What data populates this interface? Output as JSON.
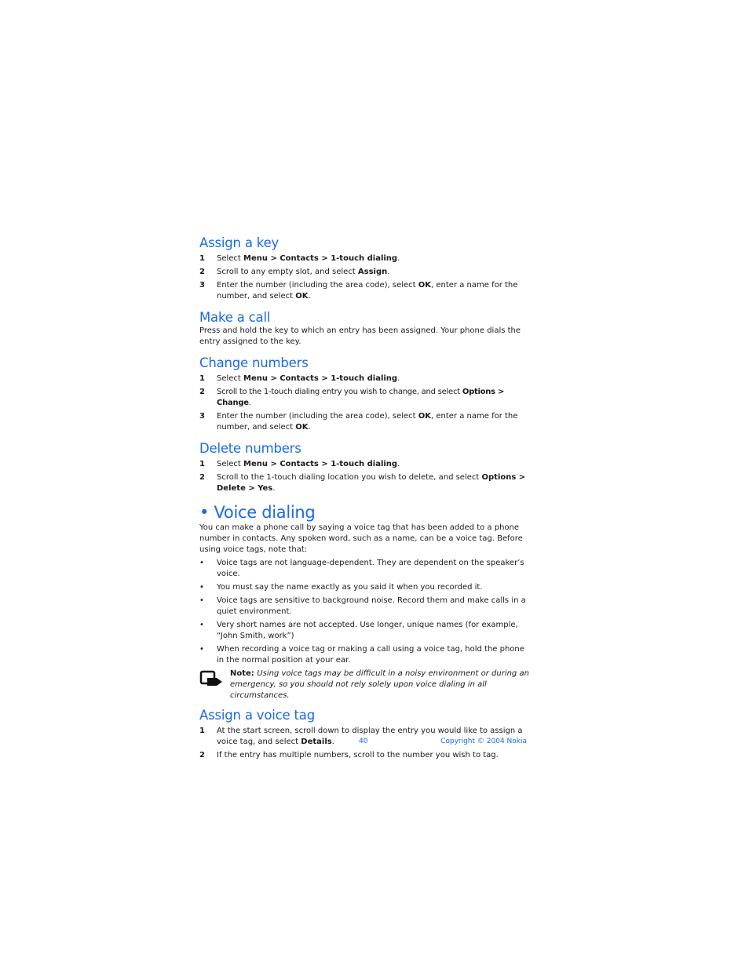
{
  "sections": {
    "assign_key": {
      "title": "Assign a key",
      "steps": [
        {
          "num": "1",
          "pre": "Select ",
          "b1": "Menu > Contacts > 1-touch dialing",
          "post": "."
        },
        {
          "num": "2",
          "pre": "Scroll to any empty slot, and select ",
          "b1": "Assign",
          "post": "."
        },
        {
          "num": "3",
          "pre": "Enter the number (including the area code), select ",
          "b1": "OK",
          "mid": ", enter a name for the number, and select ",
          "b2": "OK",
          "post": "."
        }
      ]
    },
    "make_call": {
      "title": "Make a call",
      "text": "Press and hold the key to which an entry has been assigned. Your phone dials the entry assigned to the key."
    },
    "change_numbers": {
      "title": "Change numbers",
      "steps": [
        {
          "num": "1",
          "pre": "Select ",
          "b1": "Menu > Contacts > 1-touch dialing",
          "post": "."
        },
        {
          "num": "2",
          "pre": "Scroll to the 1-touch dialing entry you wish to change, and select ",
          "b1": "Options > Change",
          "post": "."
        },
        {
          "num": "3",
          "pre": "Enter the number (including the area code), select ",
          "b1": "OK",
          "mid": ", enter a name for the number, and select ",
          "b2": "OK",
          "post": "."
        }
      ]
    },
    "delete_numbers": {
      "title": "Delete numbers",
      "steps": [
        {
          "num": "1",
          "pre": "Select ",
          "b1": "Menu > Contacts > 1-touch dialing",
          "post": "."
        },
        {
          "num": "2",
          "pre": "Scroll to the 1-touch dialing location you wish to delete, and select ",
          "b1": "Options > Delete > Yes",
          "post": "."
        }
      ]
    },
    "voice_dialing": {
      "title": "• Voice dialing",
      "intro": "You can make a phone call by saying a voice tag that has been added to a phone number in contacts. Any spoken word, such as a name, can be a voice tag. Before using voice tags, note that:",
      "bullets": [
        "Voice tags are not language-dependent. They are dependent on the speaker’s voice.",
        "You must say the name exactly as you said it when you recorded it.",
        "Voice tags are sensitive to background noise. Record them and make calls in a quiet environment.",
        "Very short names are not accepted. Use longer, unique names (for example, “John Smith, work”)",
        "When recording a voice tag or making a call using a voice tag, hold the phone in the normal position at your ear."
      ],
      "note_label": "Note: ",
      "note_text": "Using voice tags may be difficult in a noisy environment or during an emergency, so you should not rely solely upon voice dialing in all circumstances.",
      "note_icon": "note-hand-icon"
    },
    "assign_voice_tag": {
      "title": "Assign a voice tag",
      "steps": [
        {
          "num": "1",
          "pre": "At the start screen, scroll down to display the entry you would like to assign a voice tag, and select ",
          "b1": "Details",
          "post": "."
        },
        {
          "num": "2",
          "pre": "If the entry has multiple numbers, scroll to the number you wish to tag.",
          "b1": "",
          "post": ""
        }
      ]
    }
  },
  "footer": {
    "page_number": "40",
    "copyright": "Copyright © 2004 Nokia"
  }
}
